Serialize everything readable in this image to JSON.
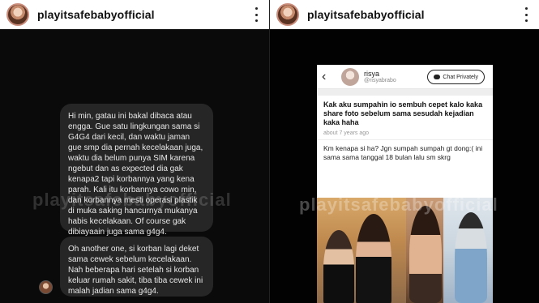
{
  "left": {
    "username": "playitsafebabyofficial",
    "watermark": "playitsafebabyofficial",
    "messages": [
      "Hi min, gatau ini bakal dibaca atau engga. Gue satu lingkungan sama si G4G4 dari kecil, dan waktu jaman gue smp dia pernah kecelakaan juga, waktu dia belum punya SIM karena ngebut dan as expected dia gak kenapa2 tapi korbannya yang kena parah. Kali itu korbannya cowo min, dan korbannya mesti operasi plastik di muka saking hancurnya mukanya habis kecelakaan. Of course gak dibiayaain juga sama g4g4.",
      "Oh another one, si korban lagi deket sama cewek sebelum kecelakaan. Nah beberapa hari setelah si korban keluar rumah sakit, tiba tiba cewek ini malah jadian sama g4g4."
    ]
  },
  "right": {
    "username": "playitsafebabyofficial",
    "watermark": "playitsafebabyofficial",
    "post": {
      "name": "risya",
      "handle": "@risyabrabo",
      "chat_label": "Chat Privately",
      "back_icon": "‹",
      "question": "Kak aku sumpahin io sembuh cepet kalo kaka share foto sebelum sama sesudah kejadian kaka haha",
      "time": "about 7 years ago",
      "answer": "Km kenapa si ha? Jgn sumpah sumpah gt dong:( ini sama sama tanggal 18 bulan lalu sm skrg"
    }
  },
  "colors": {
    "topbar": "#ffffff",
    "bubble": "#262626",
    "background": "#0a0a0a"
  }
}
